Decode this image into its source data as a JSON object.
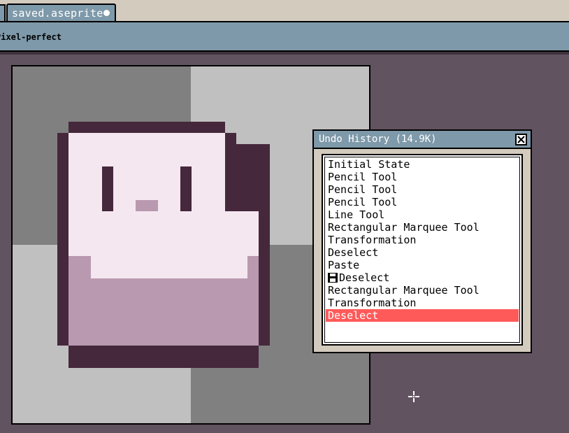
{
  "tabs": [
    {
      "title": "saved.aseprite",
      "modified": true,
      "active": true
    }
  ],
  "toolbar": {
    "option_label": "Pixel-perfect"
  },
  "undo_history": {
    "title": "Undo History (14.9K)",
    "items": [
      {
        "label": "Initial State",
        "saved": false,
        "selected": false
      },
      {
        "label": "Pencil Tool",
        "saved": false,
        "selected": false
      },
      {
        "label": "Pencil Tool",
        "saved": false,
        "selected": false
      },
      {
        "label": "Pencil Tool",
        "saved": false,
        "selected": false
      },
      {
        "label": "Line Tool",
        "saved": false,
        "selected": false
      },
      {
        "label": "Rectangular Marquee Tool",
        "saved": false,
        "selected": false
      },
      {
        "label": "Transformation",
        "saved": false,
        "selected": false
      },
      {
        "label": "Deselect",
        "saved": false,
        "selected": false
      },
      {
        "label": "Paste",
        "saved": false,
        "selected": false
      },
      {
        "label": "Deselect",
        "saved": true,
        "selected": false
      },
      {
        "label": "Rectangular Marquee Tool",
        "saved": false,
        "selected": false
      },
      {
        "label": "Transformation",
        "saved": false,
        "selected": false
      },
      {
        "label": "Deselect",
        "saved": false,
        "selected": true
      }
    ]
  },
  "icons": {
    "tab_modified": "unsaved-dot-icon",
    "close": "close-icon",
    "saved_state": "floppy-disk-icon",
    "cursor": "crosshair-icon"
  },
  "colors": {
    "workspace": "#625360",
    "panel_header": "#7e99a9",
    "panel_face": "#d3cbbe",
    "selection": "#ff5a5a",
    "sprite_outline": "#45283c",
    "sprite_light": "#f5e7f0",
    "sprite_mid": "#b999b0",
    "checker_dark": "#808080",
    "checker_light": "#c0c0c0"
  }
}
